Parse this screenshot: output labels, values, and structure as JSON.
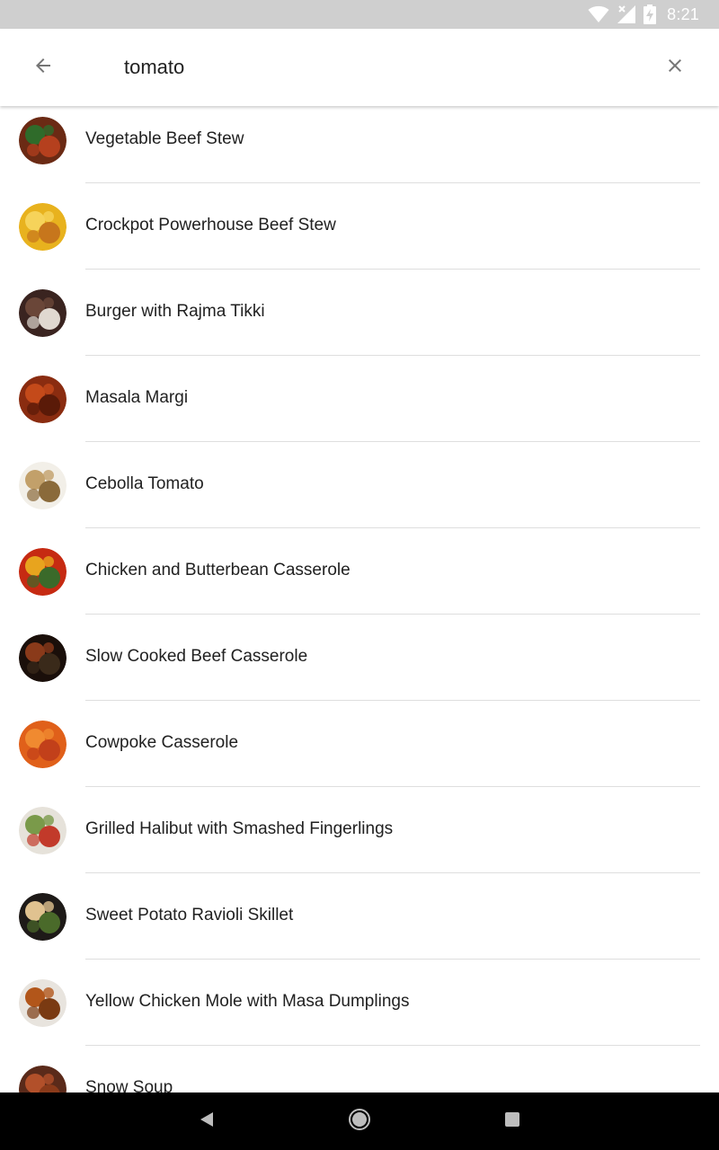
{
  "status_bar": {
    "time": "8:21",
    "icons": [
      "wifi-icon",
      "signal-no-data-icon",
      "battery-charging-icon"
    ]
  },
  "search": {
    "query": "tomato",
    "back_icon": "arrow-back-icon",
    "clear_icon": "close-icon"
  },
  "results": [
    {
      "title": "Vegetable Beef Stew",
      "colors": [
        "#6b2a14",
        "#2f6b2a",
        "#b5401e"
      ]
    },
    {
      "title": "Crockpot Powerhouse Beef Stew",
      "colors": [
        "#e8b21e",
        "#f6d35a",
        "#c7761c"
      ]
    },
    {
      "title": "Burger with Rajma Tikki",
      "colors": [
        "#3a2420",
        "#6a4638",
        "#e0d8d0"
      ]
    },
    {
      "title": "Masala Margi",
      "colors": [
        "#8a2c10",
        "#c44a1a",
        "#5a1a08"
      ]
    },
    {
      "title": "Cebolla Tomato",
      "colors": [
        "#f2efe8",
        "#c2a06a",
        "#8a6a3a"
      ]
    },
    {
      "title": "Chicken and Butterbean Casserole",
      "colors": [
        "#c62a12",
        "#e8a41e",
        "#3a6a2a"
      ]
    },
    {
      "title": "Slow Cooked Beef Casserole",
      "colors": [
        "#1a0f0a",
        "#8a3a1a",
        "#3a2a1a"
      ]
    },
    {
      "title": "Cowpoke Casserole",
      "colors": [
        "#e0601a",
        "#f08a30",
        "#c2401a"
      ]
    },
    {
      "title": "Grilled Halibut with Smashed Fingerlings",
      "colors": [
        "#e6e2da",
        "#7a9a4a",
        "#c23a2a"
      ]
    },
    {
      "title": "Sweet Potato Ravioli Skillet",
      "colors": [
        "#1e1a18",
        "#e0c290",
        "#4a6a2a"
      ]
    },
    {
      "title": "Yellow Chicken Mole with Masa Dumplings",
      "colors": [
        "#e8e4de",
        "#b2561a",
        "#7a3a12"
      ]
    },
    {
      "title": "Snow Soup",
      "colors": [
        "#5a2a1a",
        "#b2502a",
        "#8a3a1a"
      ]
    }
  ],
  "nav_bar": {
    "back_icon": "nav-back-icon",
    "home_icon": "nav-home-icon",
    "recents_icon": "nav-recents-icon"
  }
}
